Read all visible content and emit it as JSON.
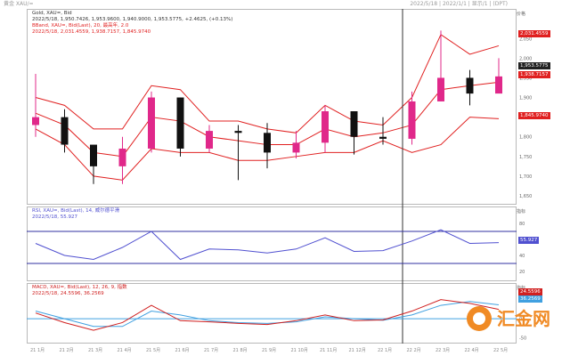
{
  "header": {
    "left": "黄金 XAU/=",
    "right": "2022/5/18 | 2022/1/1 | 显示/1 | (DPT)"
  },
  "panels": {
    "price": {
      "info1": "Gold, XAU=, Bid",
      "info2": "2022/5/18, 1,950.7426, 1,953.9600, 1,940.9000, 1,953.5775, +2.4625, (+0.13%)",
      "info3": "BBand, XAU=, Bid(Last), 20, 最高年, 2.0",
      "info4": "2022/5/18, 2,031.4559, 1,938.7157, 1,845.9740"
    },
    "rsi": {
      "info1": "RSI, XAU=, Bid(Last), 14, 威尔德平滑",
      "info2": "2022/5/18, 55.927"
    },
    "macd": {
      "info1": "MACD, XAU=, Bid(Last), 12, 26, 9, 指数",
      "info2": "2022/5/18, 24.5596, 36.2569"
    }
  },
  "axis_right": {
    "price_unit": "价格",
    "price_labels": [
      "2,050",
      "2,000",
      "1,950",
      "1,900",
      "1,850",
      "1,800",
      "1,750",
      "1,700",
      "1,650"
    ],
    "rsi_unit": "指标",
    "rsi_labels": [
      "80",
      "60",
      "40",
      "20"
    ],
    "macd_unit": "指标",
    "macd_labels": [
      "50",
      "0",
      "-50"
    ]
  },
  "badges": {
    "upper": "2,031.4559",
    "last": "1,953.5775",
    "mid": "1,938.7157",
    "lower": "1,845.9740",
    "rsi": "55.927",
    "macd1": "24.5596",
    "macd2": "36.2569"
  },
  "x_labels": [
    "21 1月",
    "21 2月",
    "21 3月",
    "21 4月",
    "21 5月",
    "21 6月",
    "21 7月",
    "21 8月",
    "21 9月",
    "21 10月",
    "21 11月",
    "21 12月",
    "22 1月",
    "22 2月",
    "22 3月",
    "22 4月",
    "22 5月"
  ],
  "logo": {
    "text": "汇金网"
  },
  "colors": {
    "up": "#e0288a",
    "down": "#111111",
    "band": "#e02020",
    "rsi": "#5050d0",
    "macd": "#d02020",
    "signal": "#40a0e0"
  },
  "chart_data": [
    {
      "type": "candlestick",
      "title": "Gold, XAU=, Bid",
      "x": [
        "2021-01",
        "2021-02",
        "2021-03",
        "2021-04",
        "2021-05",
        "2021-06",
        "2021-07",
        "2021-08",
        "2021-09",
        "2021-10",
        "2021-11",
        "2021-12",
        "2022-01",
        "2022-02",
        "2022-03",
        "2022-04",
        "2022-05"
      ],
      "close": [
        1850,
        1780,
        1725,
        1770,
        1900,
        1770,
        1815,
        1810,
        1760,
        1785,
        1865,
        1800,
        1795,
        1890,
        1950,
        1910,
        1953.58
      ],
      "high": [
        1960,
        1870,
        1760,
        1800,
        1915,
        1900,
        1830,
        1830,
        1835,
        1815,
        1880,
        1815,
        1850,
        1915,
        2070,
        1970,
        2000
      ],
      "low": [
        1800,
        1760,
        1680,
        1680,
        1760,
        1750,
        1760,
        1690,
        1720,
        1745,
        1760,
        1755,
        1780,
        1780,
        1890,
        1880,
        1930
      ],
      "bands": {
        "upper": [
          1900,
          1880,
          1820,
          1820,
          1930,
          1920,
          1840,
          1840,
          1820,
          1810,
          1880,
          1840,
          1830,
          1900,
          2060,
          2010,
          2031.46
        ],
        "middle": [
          1860,
          1830,
          1760,
          1750,
          1850,
          1840,
          1800,
          1790,
          1780,
          1780,
          1820,
          1800,
          1810,
          1830,
          1920,
          1930,
          1938.72
        ],
        "lower": [
          1820,
          1780,
          1700,
          1690,
          1770,
          1760,
          1760,
          1740,
          1740,
          1750,
          1760,
          1760,
          1790,
          1760,
          1780,
          1850,
          1845.97
        ]
      },
      "ylim": [
        1650,
        2080
      ]
    },
    {
      "type": "line",
      "title": "RSI, XAU=, Bid(Last), 14",
      "x": [
        "2021-01",
        "2021-02",
        "2021-03",
        "2021-04",
        "2021-05",
        "2021-06",
        "2021-07",
        "2021-08",
        "2021-09",
        "2021-10",
        "2021-11",
        "2021-12",
        "2022-01",
        "2022-02",
        "2022-03",
        "2022-04",
        "2022-05"
      ],
      "values": [
        55,
        40,
        35,
        50,
        70,
        35,
        48,
        47,
        43,
        48,
        62,
        45,
        46,
        58,
        72,
        55,
        55.93
      ],
      "reference": [
        70,
        30
      ],
      "ylim": [
        10,
        90
      ]
    },
    {
      "type": "line",
      "title": "MACD, XAU=, Bid(Last), 12, 26, 9",
      "x": [
        "2021-01",
        "2021-02",
        "2021-03",
        "2021-04",
        "2021-05",
        "2021-06",
        "2021-07",
        "2021-08",
        "2021-09",
        "2021-10",
        "2021-11",
        "2021-12",
        "2022-01",
        "2022-02",
        "2022-03",
        "2022-04",
        "2022-05"
      ],
      "series": [
        {
          "name": "MACD",
          "values": [
            15,
            -10,
            -30,
            -10,
            35,
            -5,
            -8,
            -12,
            -15,
            -5,
            10,
            -5,
            -3,
            20,
            50,
            40,
            24.56
          ]
        },
        {
          "name": "Signal",
          "values": [
            20,
            0,
            -20,
            -20,
            20,
            10,
            -5,
            -10,
            -12,
            -8,
            5,
            0,
            -4,
            10,
            35,
            45,
            36.26
          ]
        }
      ],
      "ylim": [
        -60,
        70
      ]
    }
  ]
}
